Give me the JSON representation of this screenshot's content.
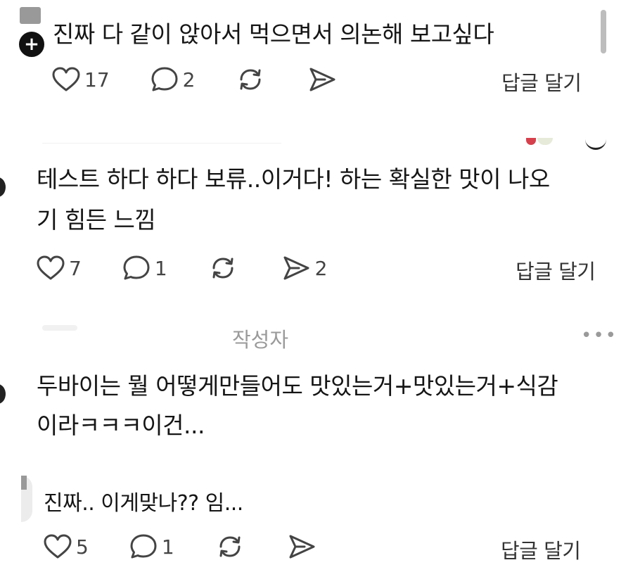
{
  "posts": [
    {
      "lines": [
        "진짜 다 같이 앉아서 먹으면서 의논해 보고싶다"
      ],
      "likes": "17",
      "comments": "2",
      "shares": "",
      "reply_label": "답글 달기"
    },
    {
      "lines": [
        "테스트 하다 하다 보류..이거다! 하는 확실한 맛이 나오",
        "기 힘든 느낌"
      ],
      "likes": "7",
      "comments": "1",
      "shares": "2",
      "reply_label": "답글 달기"
    },
    {
      "author_label": "작성자",
      "more_label": "•••",
      "lines": [
        "두바이는 뭘 어떻게만들어도 맛있는거+맛있는거+식감",
        "이라ㅋㅋㅋ이건..."
      ]
    },
    {
      "lines": [
        "진짜.. 이게맞나?? 임..."
      ],
      "likes": "5",
      "comments": "1",
      "shares": "",
      "reply_label": "답글 달기"
    }
  ],
  "icons": {
    "like": "heart-icon",
    "comment": "comment-bubble-icon",
    "repost": "repost-icon",
    "share": "send-icon",
    "add": "plus-icon",
    "more": "more-icon"
  },
  "colors": {
    "text": "#151515",
    "muted": "#9a9a9a",
    "icon": "#444444"
  }
}
